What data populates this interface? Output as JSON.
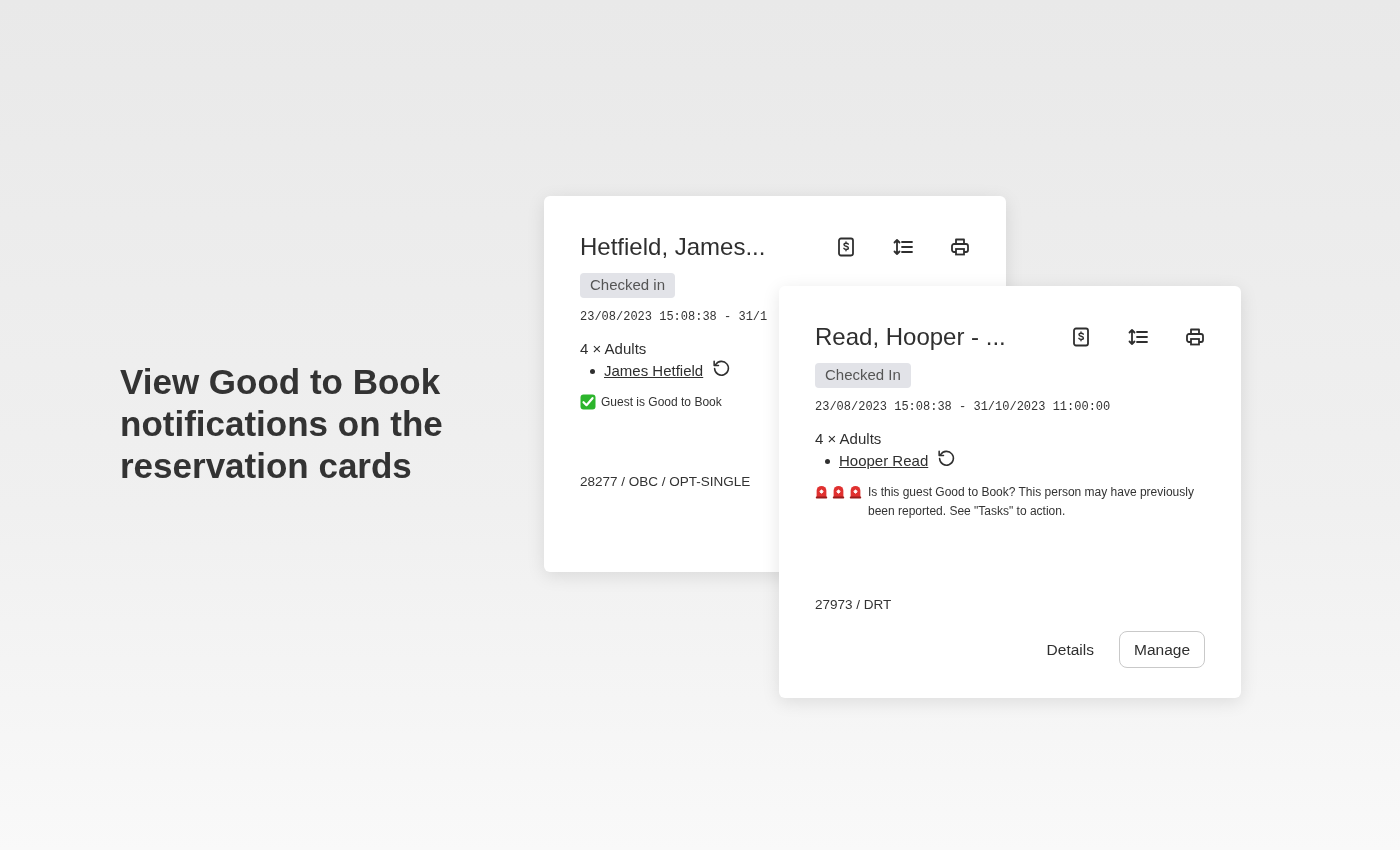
{
  "headline": "View Good to Book notifications on the reservation cards",
  "cards": [
    {
      "title": "Hetfield, James...",
      "status": "Checked in",
      "dates": "23/08/2023 15:08:38 - 31/1",
      "guest_count": "4 × Adults",
      "guests": [
        "James Hetfield"
      ],
      "notice": {
        "kind": "ok",
        "text": "Guest is Good to Book"
      },
      "reference": "28277 / OBC / OPT-SINGLE"
    },
    {
      "title": "Read, Hooper - ...",
      "status": "Checked In",
      "dates": "23/08/2023 15:08:38 - 31/10/2023 11:00:00",
      "guest_count": "4 × Adults",
      "guests": [
        "Hooper Read"
      ],
      "notice": {
        "kind": "alert",
        "text": "Is this guest Good to Book? This person may have previously been reported. See \"Tasks\" to action."
      },
      "reference": "27973 / DRT",
      "buttons": [
        {
          "label": "Details",
          "kind": "text"
        },
        {
          "label": "Manage",
          "kind": "outline"
        }
      ]
    }
  ]
}
